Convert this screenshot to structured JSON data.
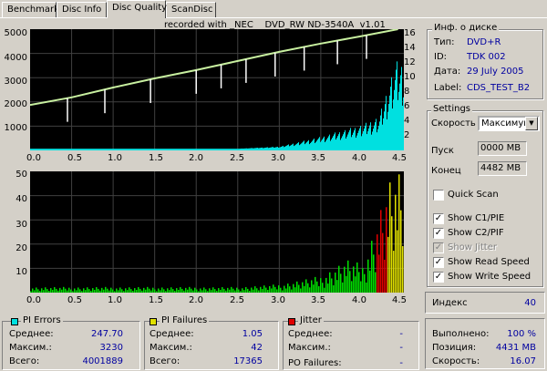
{
  "tabs": [
    "Benchmark",
    "Disc Info",
    "Disc Quality",
    "ScanDisc"
  ],
  "active_tab": "Disc Quality",
  "recorded_with": "recorded with _NEC    DVD_RW ND-3540A  v1.01",
  "disc_info": {
    "title": "Инф. о диске",
    "type_label": "Тип:",
    "type_value": "DVD+R",
    "id_label": "ID:",
    "id_value": "TDK 002",
    "date_label": "Дата:",
    "date_value": "29 July 2005",
    "label_label": "Label:",
    "label_value": "CDS_TEST_B2"
  },
  "settings": {
    "title": "Settings",
    "speed_label": "Скорость",
    "speed_value": "Максимум",
    "start_label": "Пуск",
    "start_value": "0000 MB",
    "end_label": "Конец",
    "end_value": "4482 MB",
    "quick_scan": "Quick Scan",
    "show_c1": "Show C1/PIE",
    "show_c2": "Show C2/PIF",
    "show_jitter": "Show Jitter",
    "show_read": "Show Read Speed",
    "show_write": "Show Write Speed"
  },
  "index": {
    "label": "Индекс",
    "value": "40"
  },
  "progress": {
    "done_label": "Выполнено:",
    "done_value": "100 %",
    "pos_label": "Позиция:",
    "pos_value": "4431 MB",
    "speed_label": "Скорость:",
    "speed_value": "16.07"
  },
  "pi_errors": {
    "title": "PI Errors",
    "avg_label": "Среднее:",
    "avg": "247.70",
    "max_label": "Максим.:",
    "max": "3230",
    "total_label": "Всего:",
    "total": "4001889",
    "color": "#00e0e0"
  },
  "pi_failures": {
    "title": "PI Failures",
    "avg_label": "Среднее:",
    "avg": "1.05",
    "max_label": "Максим.:",
    "max": "42",
    "total_label": "Всего:",
    "total": "17365",
    "color": "#e0e000"
  },
  "jitter": {
    "title": "Jitter",
    "avg_label": "Среднее:",
    "avg": "-",
    "max_label": "Максим.:",
    "max": "-",
    "po_label": "PO Failures:",
    "po": "-",
    "color": "#e00000"
  },
  "chart_top": {
    "y_left": [
      "5000",
      "4000",
      "3000",
      "2000",
      "1000"
    ],
    "y_right": [
      "16",
      "14",
      "12",
      "10",
      "8",
      "6",
      "4",
      "2"
    ]
  },
  "chart_bottom": {
    "y_left": [
      "50",
      "40",
      "30",
      "20",
      "10"
    ]
  },
  "x_ticks": [
    "0.0",
    "0.5",
    "1.0",
    "1.5",
    "2.0",
    "2.5",
    "3.0",
    "3.5",
    "4.0",
    "4.5"
  ],
  "chart_data": [
    {
      "type": "area",
      "title": "",
      "xlabel": "",
      "ylabel": "",
      "xlim": [
        0,
        4.5
      ],
      "ylim": [
        0,
        5000
      ],
      "y2lim": [
        0,
        16
      ],
      "series": [
        {
          "x": [
            0,
            0.5,
            1.0,
            1.5,
            2.0,
            2.5,
            3.0,
            3.5,
            4.0,
            4.2,
            4.3,
            4.4
          ],
          "values": [
            0,
            0,
            0,
            0,
            0,
            0,
            80,
            450,
            900,
            1200,
            2300,
            3230
          ]
        },
        {
          "x": [
            0,
            0.5,
            1.0,
            1.5,
            2.0,
            2.5,
            3.0,
            3.5,
            4.0,
            4.43
          ],
          "values": [
            6,
            7,
            8.3,
            9.5,
            10.6,
            11.8,
            13,
            14.1,
            15.1,
            16
          ]
        }
      ]
    },
    {
      "type": "bar",
      "title": "",
      "xlabel": "",
      "ylabel": "",
      "xlim": [
        0,
        4.5
      ],
      "ylim": [
        0,
        50
      ],
      "series": [
        {
          "x": [
            0,
            0.5,
            1.0,
            1.5,
            2.0,
            2.5,
            3.0,
            3.5,
            3.8,
            4.0,
            4.2,
            4.3,
            4.4
          ],
          "values": [
            2,
            2,
            2,
            2,
            2,
            2,
            3,
            6,
            12,
            10,
            30,
            40,
            42
          ]
        }
      ]
    }
  ]
}
